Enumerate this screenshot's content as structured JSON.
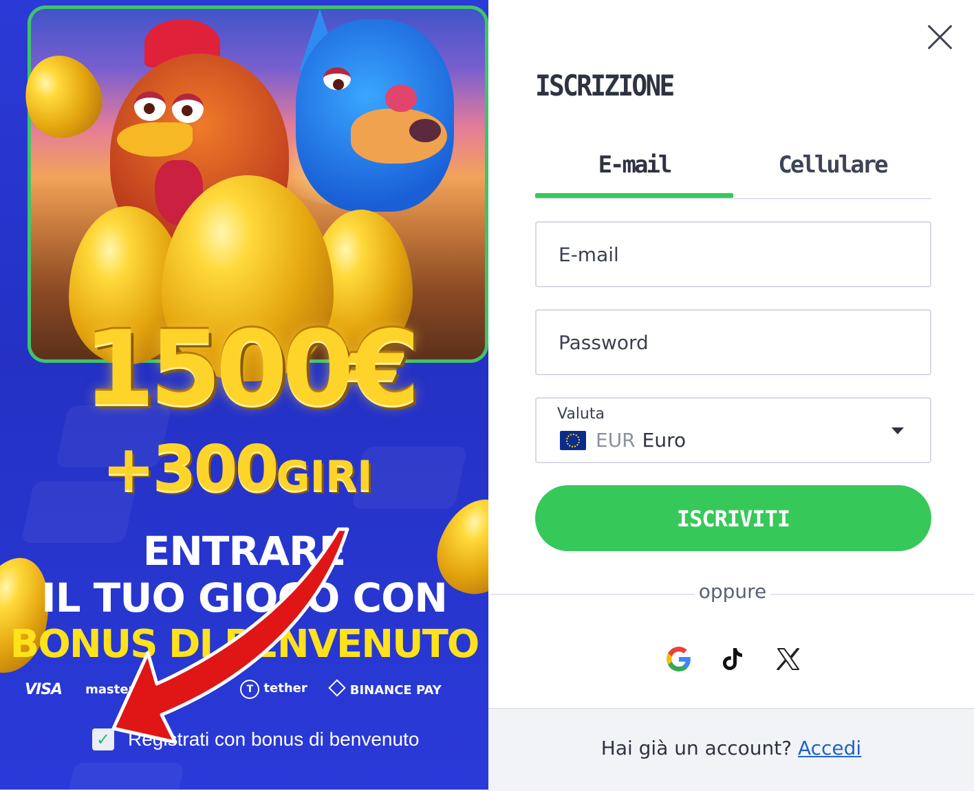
{
  "promo": {
    "amount": "1500€",
    "spins_number": "+300",
    "spins_word": "GIRI",
    "line1": "ENTRARE",
    "line2": "IL TUO GIOCO CON",
    "line3": "BONUS DI BENVENUTO",
    "payments": [
      "VISA",
      "master",
      "tether",
      "BINANCE PAY"
    ],
    "bonus_checkbox_label": "Registrati con bonus di benvenuto",
    "bonus_checked": true
  },
  "form": {
    "title": "ISCRIZIONE",
    "tabs": [
      {
        "label": "E-mail",
        "active": true
      },
      {
        "label": "Cellulare",
        "active": false
      }
    ],
    "email_placeholder": "E-mail",
    "password_placeholder": "Password",
    "currency_label": "Valuta",
    "currency_code": "EUR",
    "currency_name": "Euro",
    "submit_label": "ISCRIVITI",
    "or_text": "oppure",
    "social": [
      "google-icon",
      "tiktok-icon",
      "x-icon"
    ],
    "footer_text": "Hai già un account?",
    "footer_link": "Accedi"
  },
  "colors": {
    "accent_green": "#37c85a",
    "promo_blue": "#2b3ad6",
    "link_blue": "#2262c8",
    "gold": "#ffd42a"
  }
}
